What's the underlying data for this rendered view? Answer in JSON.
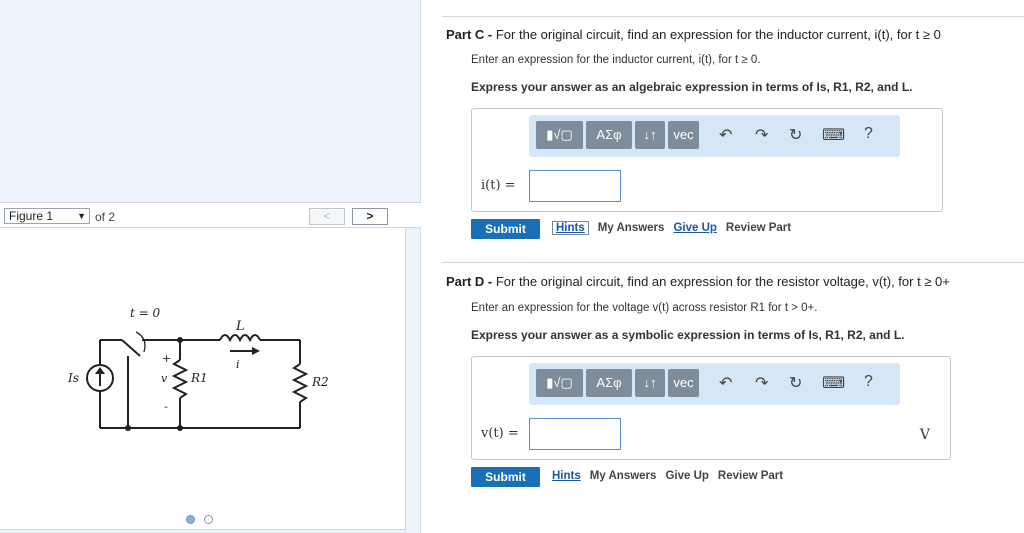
{
  "figure_nav": {
    "select_value": "Figure 1",
    "select_caret": "▼",
    "of_text": "of 2",
    "prev_label": "<",
    "next_label": ">"
  },
  "circuit_labels": {
    "switch_time": "t = 0",
    "inductor": "L",
    "current": "i",
    "source": "Is",
    "voltage": "v",
    "r1": "R1",
    "r2": "R2",
    "plus": "+",
    "minus": "-"
  },
  "part_c": {
    "label": "Part C -",
    "title": "For the original circuit, find an expression for the inductor current, i(t), for t ≥ 0",
    "instruction": "Enter an expression for the inductor current, i(t), for t ≥ 0.",
    "express": "Express your answer as an algebraic expression in terms of Is, R1, R2, and L.",
    "answer_label": "i(t) =",
    "submit": "Submit",
    "hints": "Hints",
    "my_answers": "My Answers",
    "give_up": "Give Up",
    "review_part": "Review Part"
  },
  "part_d": {
    "label": "Part D -",
    "title": "For the original circuit, find an expression for the resistor voltage, v(t), for t ≥ 0+",
    "instruction": "Enter an expression for the voltage v(t) across resistor R1 for t > 0+.",
    "express": "Express your answer as a symbolic expression in terms of Is, R1, R2, and L.",
    "answer_label": "v(t) =",
    "unit": "V",
    "submit": "Submit",
    "hints": "Hints",
    "my_answers": "My Answers",
    "give_up": "Give Up",
    "review_part": "Review Part"
  },
  "toolbar": {
    "templates": "▮√▢",
    "greek": "ΑΣφ",
    "arrows": "↓↑",
    "vec": "vec",
    "undo": "↶",
    "redo": "↷",
    "reset": "↻",
    "keyboard": "⌨",
    "help": "?"
  },
  "colors": {
    "submit": "#1a6fb6",
    "toolbar_bg": "#d5e6f6",
    "toolbar_btn": "#7f8c9b",
    "link": "#1b57a2"
  }
}
